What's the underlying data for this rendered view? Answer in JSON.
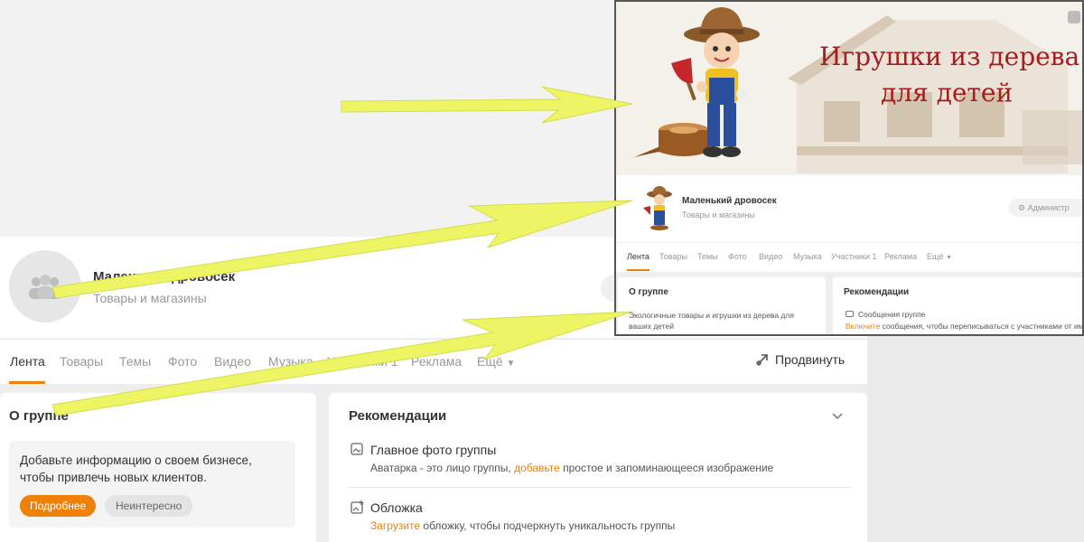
{
  "group": {
    "name": "Маленький дровосек",
    "category": "Товары и магазины"
  },
  "tabs": [
    {
      "label": "Лента",
      "active": true
    },
    {
      "label": "Товары"
    },
    {
      "label": "Темы"
    },
    {
      "label": "Фото"
    },
    {
      "label": "Видео"
    },
    {
      "label": "Музыка"
    },
    {
      "label": "Участники 1"
    },
    {
      "label": "Реклама"
    },
    {
      "label": "Ещё"
    }
  ],
  "promote_label": "Продвинуть",
  "about": {
    "title": "О группе",
    "business_text": "Добавьте информацию о своем бизнесе, чтобы привлечь новых клиентов.",
    "more_button": "Подробнее",
    "not_interested_button": "Неинтересно"
  },
  "recommendations": {
    "title": "Рекомендации",
    "items": [
      {
        "title": "Главное фото группы",
        "sub_before": "Аватарка - это лицо группы, ",
        "sub_link": "добавьте",
        "sub_after": " простое и запоминающееся изображение"
      },
      {
        "title": "Обложка",
        "sub_before": "",
        "sub_link": "Загрузите",
        "sub_after": " обложку, чтобы подчеркнуть уникальность группы"
      }
    ]
  },
  "inset": {
    "banner_line1": "Игрушки из дерева",
    "banner_line2": "для детей",
    "group_name": "Маленький дровосек",
    "group_category": "Товары и магазины",
    "admin_label": "Администр",
    "tabs": [
      "Лента",
      "Товары",
      "Темы",
      "Фото",
      "Видео",
      "Музыка",
      "Участники 1",
      "Реклама",
      "Ещё"
    ],
    "about_title": "О группе",
    "about_text": "Экологичные товары и игрушки из дерева для ваших детей",
    "rec_title": "Рекомендации",
    "rec_item_title": "Сообщения группе",
    "rec_item_link": "Включите",
    "rec_item_after": " сообщения, чтобы переписываться с участниками от имен"
  },
  "colors": {
    "accent": "#ee8208",
    "arrow": "#eef565",
    "banner_text": "#a61c1c"
  }
}
